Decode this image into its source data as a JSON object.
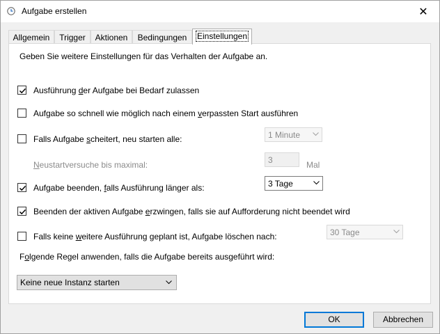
{
  "window": {
    "title": "Aufgabe erstellen",
    "close_glyph": "✕"
  },
  "tabs": [
    {
      "label": "Allgemein"
    },
    {
      "label": "Trigger"
    },
    {
      "label": "Aktionen"
    },
    {
      "label": "Bedingungen"
    },
    {
      "label": "Einstellungen",
      "active": true
    }
  ],
  "panel": {
    "description": "Geben Sie weitere Einstellungen für das Verhalten der Aufgabe an.",
    "opt_demand": {
      "pre": "Ausführung ",
      "key": "d",
      "post": "er Aufgabe bei Bedarf zulassen",
      "checked": true
    },
    "opt_missed": {
      "pre": "Aufgabe so schnell wie möglich nach einem ",
      "key": "v",
      "post": "erpassten Start ausführen",
      "checked": false
    },
    "opt_restart": {
      "pre": "Falls Aufgabe ",
      "key": "s",
      "post": "cheitert, neu starten alle:",
      "checked": false,
      "interval": "1 Minute"
    },
    "retry": {
      "key": "N",
      "post": "eustartversuche bis maximal:",
      "value": "3",
      "unit": "Mal"
    },
    "opt_stop": {
      "pre": "Aufgabe beenden, ",
      "key": "f",
      "post": "alls Ausführung länger als:",
      "checked": true,
      "duration": "3 Tage"
    },
    "opt_force": {
      "pre": "Beenden der aktiven Aufgabe ",
      "key": "e",
      "post": "rzwingen, falls sie auf Aufforderung nicht beendet wird",
      "checked": true
    },
    "opt_delete": {
      "pre": "Falls keine ",
      "key": "w",
      "post": "eitere Ausführung geplant ist, Aufgabe löschen nach:",
      "checked": false,
      "delay": "30 Tage"
    },
    "rule": {
      "pre": "F",
      "key": "o",
      "post": "lgende Regel anwenden, falls die Aufgabe bereits ausgeführt wird:",
      "selected": "Keine neue Instanz starten"
    }
  },
  "buttons": {
    "ok": "OK",
    "cancel": "Abbrechen"
  },
  "colors": {
    "accent": "#0078d7",
    "disabled_text": "#8a8a8a"
  }
}
